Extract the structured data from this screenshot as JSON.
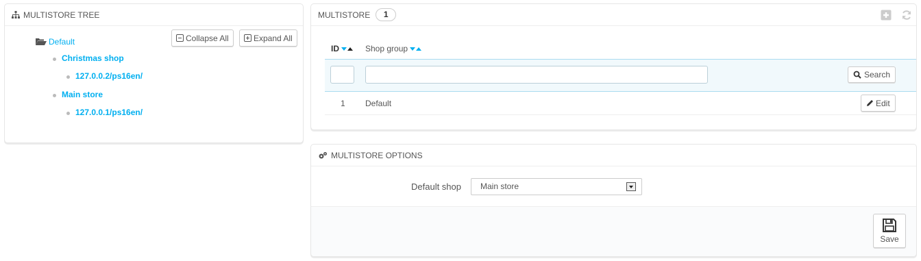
{
  "tree_panel": {
    "title": "MULTISTORE TREE",
    "collapse_label": "Collapse All",
    "expand_label": "Expand All",
    "root": "Default",
    "shops": [
      {
        "name": "Christmas shop",
        "url": "127.0.0.2/ps16en/"
      },
      {
        "name": "Main store",
        "url": "127.0.0.1/ps16en/"
      }
    ]
  },
  "multistore_panel": {
    "title": "MULTISTORE",
    "count": "1",
    "columns": {
      "id": "ID",
      "shop_group": "Shop group"
    },
    "search_label": "Search",
    "filter_id": "",
    "filter_group": "",
    "rows": [
      {
        "id": "1",
        "group": "Default",
        "action": "Edit"
      }
    ]
  },
  "options_panel": {
    "title": "MULTISTORE OPTIONS",
    "default_shop_label": "Default shop",
    "default_shop_value": "Main store",
    "save_label": "Save"
  },
  "icons": {
    "tree": "sitemap-icon",
    "folder": "folder-open-icon",
    "add": "add-icon",
    "refresh": "refresh-icon",
    "search": "search-icon",
    "edit": "pencil-icon",
    "options": "cogs-icon",
    "save": "floppy-disk-icon"
  },
  "colors": {
    "link": "#00aff0",
    "filter_bg": "#f1f9fc"
  }
}
